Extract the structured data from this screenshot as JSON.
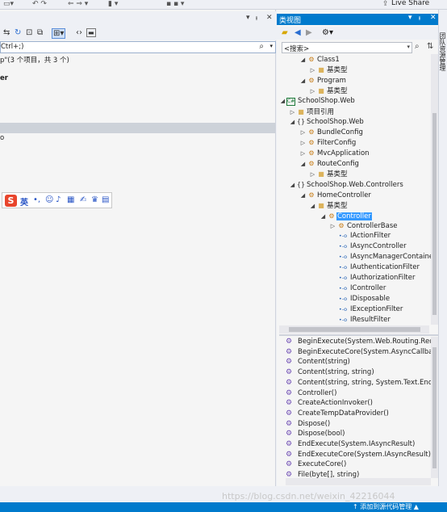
{
  "topbar": {
    "live_share": "Live Share"
  },
  "solution_explorer": {
    "search_value": "Ctrl+;)",
    "summary_line": "p\"(3 个项目，共 3 个)",
    "bold_fragment": "er",
    "item_fragment": "o"
  },
  "ime": {
    "lang": "英"
  },
  "class_view": {
    "title": "类视图",
    "search_value": "<搜索>",
    "tree": [
      {
        "label": "Class1",
        "icon": "class-icon",
        "expanded": true
      },
      {
        "label": "基类型",
        "icon": "folder-icon",
        "expanded": false
      },
      {
        "label": "Program",
        "icon": "class-icon",
        "expanded": true
      },
      {
        "label": "基类型",
        "icon": "folder-icon",
        "expanded": false
      },
      {
        "label": "SchoolShop.Web",
        "icon": "csharp-project-icon",
        "expanded": true
      },
      {
        "label": "项目引用",
        "icon": "folder-icon",
        "expanded": false
      },
      {
        "label": "SchoolShop.Web",
        "icon": "namespace-icon",
        "expanded": true
      },
      {
        "label": "BundleConfig",
        "icon": "class-icon",
        "expanded": false
      },
      {
        "label": "FilterConfig",
        "icon": "class-icon",
        "expanded": false
      },
      {
        "label": "MvcApplication",
        "icon": "class-icon",
        "expanded": false
      },
      {
        "label": "RouteConfig",
        "icon": "class-icon",
        "expanded": true
      },
      {
        "label": "基类型",
        "icon": "folder-icon",
        "expanded": false
      },
      {
        "label": "SchoolShop.Web.Controllers",
        "icon": "namespace-icon",
        "expanded": true
      },
      {
        "label": "HomeController",
        "icon": "class-icon",
        "expanded": true
      },
      {
        "label": "基类型",
        "icon": "folder-icon",
        "expanded": true
      },
      {
        "label": "Controller",
        "icon": "class-icon",
        "expanded": true,
        "selected": true
      },
      {
        "label": "ControllerBase",
        "icon": "class-icon",
        "expanded": false
      },
      {
        "label": "IActionFilter",
        "icon": "interface-icon",
        "expanded": null
      },
      {
        "label": "IAsyncController",
        "icon": "interface-icon",
        "expanded": null
      },
      {
        "label": "IAsyncManagerContainer",
        "icon": "interface-icon",
        "expanded": null
      },
      {
        "label": "IAuthenticationFilter",
        "icon": "interface-icon",
        "expanded": null
      },
      {
        "label": "IAuthorizationFilter",
        "icon": "interface-icon",
        "expanded": null
      },
      {
        "label": "IController",
        "icon": "interface-icon",
        "expanded": null
      },
      {
        "label": "IDisposable",
        "icon": "interface-icon",
        "expanded": null
      },
      {
        "label": "IExceptionFilter",
        "icon": "interface-icon",
        "expanded": null
      },
      {
        "label": "IResultFilter",
        "icon": "interface-icon",
        "expanded": null
      }
    ],
    "members": [
      "BeginExecute(System.Web.Routing.Request",
      "BeginExecuteCore(System.AsyncCallback, o",
      "Content(string)",
      "Content(string, string)",
      "Content(string, string, System.Text.Encoding",
      "Controller()",
      "CreateActionInvoker()",
      "CreateTempDataProvider()",
      "Dispose()",
      "Dispose(bool)",
      "EndExecute(System.IAsyncResult)",
      "EndExecuteCore(System.IAsyncResult)",
      "ExecuteCore()",
      "File(byte[], string)"
    ]
  },
  "right_strip": {
    "label": "团队资源管理"
  },
  "statusbar": {
    "text": "↑ 添加到源代码管理 ▲"
  },
  "watermark": "https://blog.csdn.net/weixin_42216044",
  "colors": {
    "accent": "#007acc",
    "selection": "#3399ff"
  }
}
